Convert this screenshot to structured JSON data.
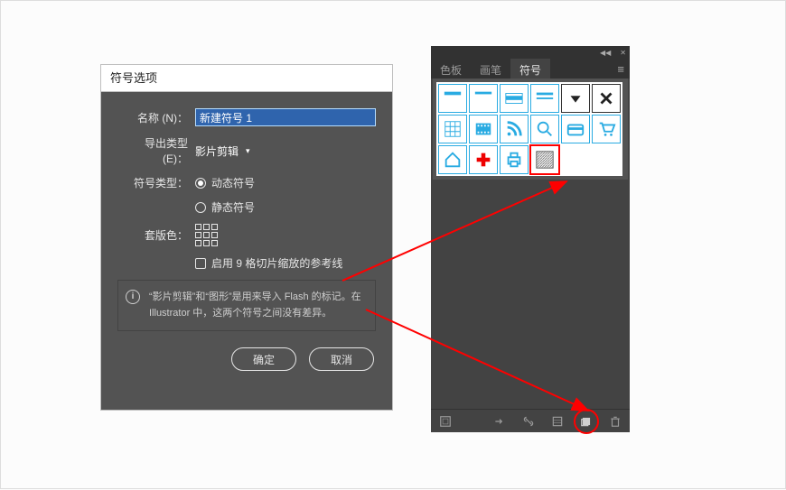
{
  "dialog": {
    "title": "符号选项",
    "labels": {
      "name": "名称 (N)：",
      "exportType": "导出类型 (E)：",
      "symbolType": "符号类型：",
      "registration": "套版色："
    },
    "nameValue": "新建符号 1",
    "exportTypeValue": "影片剪辑",
    "radios": {
      "dynamic": "动态符号",
      "static": "静态符号"
    },
    "checkbox": "启用 9 格切片缩放的参考线",
    "infoText": "“影片剪辑”和“图形”是用来导入 Flash 的标记。在 Illustrator 中，这两个符号之间没有差异。",
    "buttons": {
      "ok": "确定",
      "cancel": "取消"
    }
  },
  "panel": {
    "tabs": [
      "色板",
      "画笔",
      "符号"
    ],
    "activeTab": 2,
    "swatchNames": [
      "sw-bar-top",
      "sw-bar-2",
      "sw-card-band",
      "sw-bar-dash",
      "sw-dropdown-icon",
      "sw-close-icon",
      "sw-grid-icon",
      "sw-filmstrip-icon",
      "sw-rss-icon",
      "sw-magnify-icon",
      "sw-creditcard-icon",
      "sw-cart-icon",
      "sw-home-icon",
      "sw-plus-red-icon",
      "sw-printer-icon",
      "sw-hatch-pattern"
    ],
    "selectedIndex": 15,
    "footer": [
      "library",
      "line",
      "arrow",
      "link-break",
      "list",
      "new",
      "trash"
    ]
  }
}
